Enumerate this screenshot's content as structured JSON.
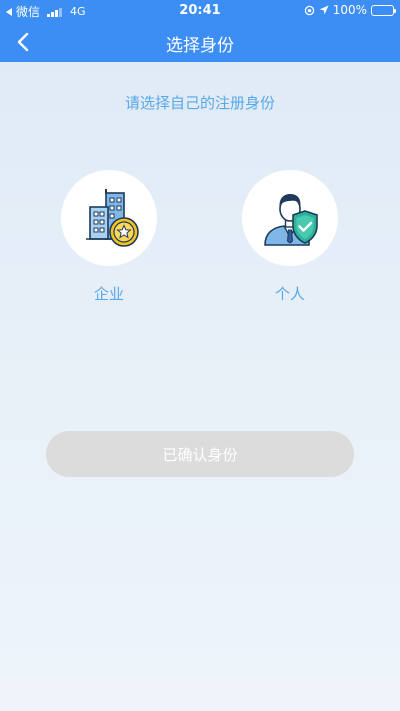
{
  "status_bar": {
    "carrier": "微信",
    "network": "4G",
    "time": "20:41",
    "battery": "100%"
  },
  "nav": {
    "title": "选择身份",
    "back_icon": "chevron-left-icon"
  },
  "prompt": "请选择自己的注册身份",
  "options": [
    {
      "label": "企业",
      "icon": "building-star-icon"
    },
    {
      "label": "个人",
      "icon": "person-shield-icon"
    }
  ],
  "confirm_button": "已确认身份",
  "colors": {
    "header": "#3c8ef5",
    "accent_text": "#59a8e8",
    "button_disabled": "#dcdcdc"
  }
}
